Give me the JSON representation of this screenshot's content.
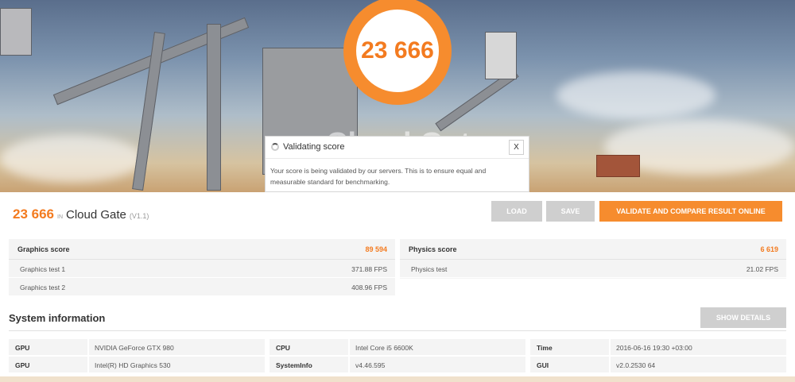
{
  "hero": {
    "score": "23 666",
    "background_title": "Cloud Gate"
  },
  "dialog": {
    "title": "Validating score",
    "close_label": "X",
    "message": "Your score is being validated by our servers. This is to ensure equal and measurable standard for benchmarking."
  },
  "result": {
    "score": "23 666",
    "in_label": "IN",
    "benchmark_name": "Cloud Gate",
    "version": "(V1.1)"
  },
  "buttons": {
    "load": "LOAD",
    "save": "SAVE",
    "validate": "VALIDATE AND COMPARE RESULT ONLINE",
    "show_details": "SHOW DETAILS"
  },
  "graphics": {
    "label": "Graphics score",
    "value": "89 594",
    "tests": [
      {
        "name": "Graphics test 1",
        "value": "371.88 FPS"
      },
      {
        "name": "Graphics test 2",
        "value": "408.96 FPS"
      }
    ]
  },
  "physics": {
    "label": "Physics score",
    "value": "6 619",
    "tests": [
      {
        "name": "Physics test",
        "value": "21.02 FPS"
      }
    ]
  },
  "system": {
    "title": "System information",
    "columns": [
      [
        {
          "key": "GPU",
          "value": "NVIDIA GeForce GTX 980"
        },
        {
          "key": "GPU",
          "value": "Intel(R) HD Graphics 530"
        }
      ],
      [
        {
          "key": "CPU",
          "value": "Intel Core i5 6600K"
        },
        {
          "key": "SystemInfo",
          "value": "v4.46.595"
        }
      ],
      [
        {
          "key": "Time",
          "value": "2016-06-16 19:30 +03:00"
        },
        {
          "key": "GUI",
          "value": "v2.0.2530 64"
        }
      ]
    ]
  },
  "colors": {
    "accent": "#f68c2e",
    "accent_text": "#f37b20",
    "button_disabled": "#cfcfcf",
    "panel_bg": "#f4f4f4"
  }
}
